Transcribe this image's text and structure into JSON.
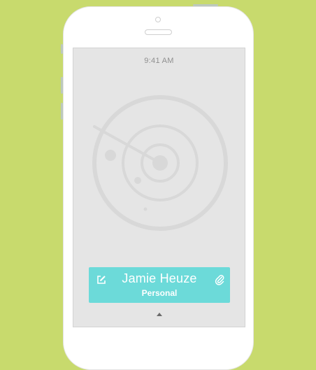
{
  "status_bar": {
    "time": "9:41 AM"
  },
  "contact_card": {
    "name": "Jamie Heuze",
    "type": "Personal",
    "left_icon": "edit-icon",
    "right_icon": "paperclip-icon"
  },
  "colors": {
    "background": "#c8da6d",
    "phone": "#ffffff",
    "screen": "#e5e5e5",
    "radar": "#d8d8d8",
    "card": "#6cdad9",
    "card_text": "#ffffff"
  }
}
